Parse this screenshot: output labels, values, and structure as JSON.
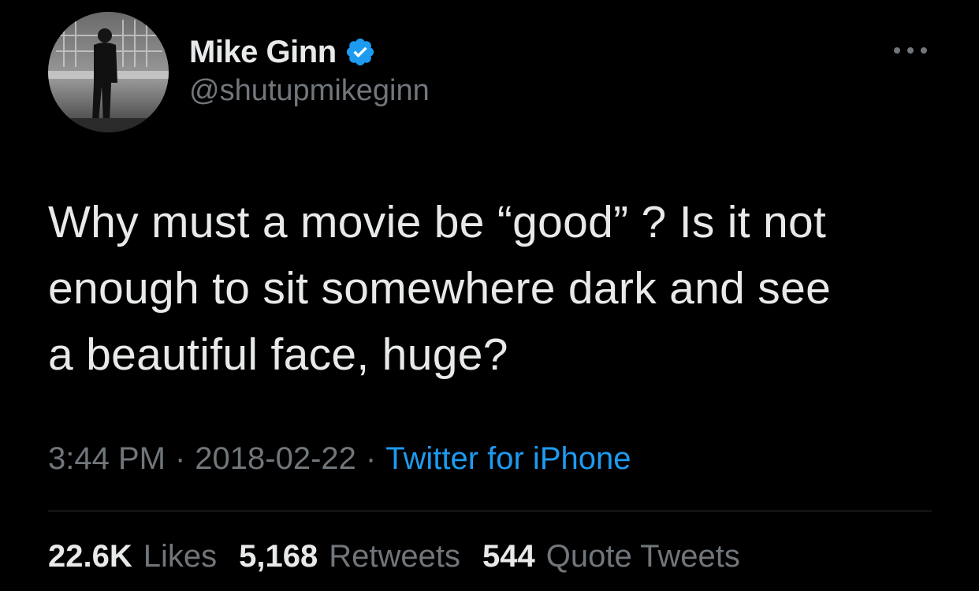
{
  "user": {
    "display_name": "Mike Ginn",
    "handle": "@shutupmikeginn",
    "verified_color": "#1d9bf0",
    "avatar_icon": "profile-photo"
  },
  "tweet": {
    "text": "Why must a movie be “good” ? Is it not\nenough to sit somewhere dark and see\na beautiful face, huge?"
  },
  "meta": {
    "time": "3:44 PM",
    "date": "2018-02-22",
    "separator": "·",
    "source": "Twitter for iPhone"
  },
  "stats": [
    {
      "value": "22.6K",
      "label": "Likes"
    },
    {
      "value": "5,168",
      "label": "Retweets"
    },
    {
      "value": "544",
      "label": "Quote Tweets"
    }
  ],
  "colors": {
    "background": "#000000",
    "text": "#e7e9ea",
    "muted": "#71767b",
    "link": "#1d9bf0",
    "divider": "#2f3336"
  }
}
